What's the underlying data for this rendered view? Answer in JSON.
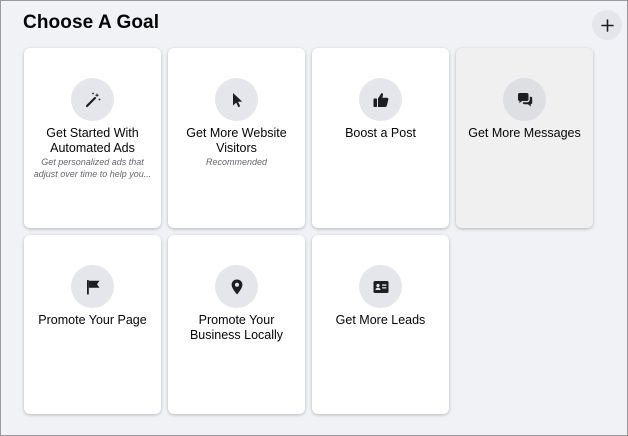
{
  "header": {
    "title": "Choose A Goal",
    "add_icon": "plus-icon"
  },
  "goals": [
    {
      "title": "Get Started With Automated Ads",
      "description": "Get personalized ads that adjust over time to help you...",
      "icon": "magic-wand-icon"
    },
    {
      "title": "Get More Website Visitors",
      "description": "Recommended",
      "icon": "cursor-icon"
    },
    {
      "title": "Boost a Post",
      "icon": "thumbs-up-icon"
    },
    {
      "title": "Get More Messages",
      "icon": "chat-bubbles-icon",
      "selected": true
    },
    {
      "title": "Promote Your Page",
      "icon": "flag-icon"
    },
    {
      "title": "Promote Your Business Locally",
      "icon": "location-pin-icon"
    },
    {
      "title": "Get More Leads",
      "icon": "id-card-icon"
    }
  ]
}
